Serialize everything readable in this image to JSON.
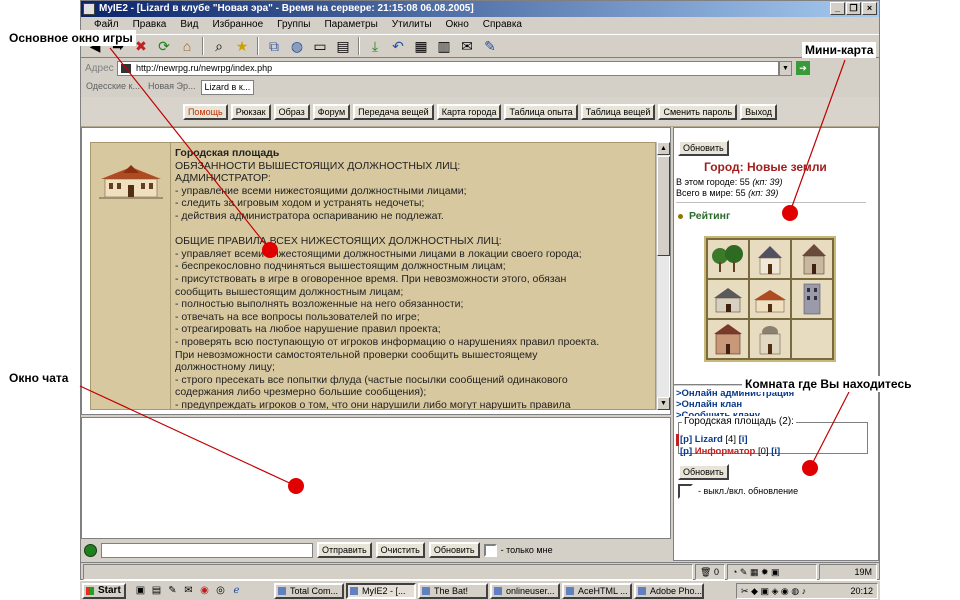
{
  "window": {
    "title": "MyIE2 - [Lizard в клубе \"Новая эра\" - Время на сервере: 21:15:08 06.08.2005]",
    "controls": [
      "_",
      "❐",
      "×"
    ]
  },
  "menu": [
    "Файл",
    "Правка",
    "Вид",
    "Избранное",
    "Группы",
    "Параметры",
    "Утилиты",
    "Окно",
    "Справка"
  ],
  "address": {
    "label": "Адрес",
    "url": "http://newrpg.ru/newrpg/index.php"
  },
  "page_tabs": [
    "Одесские к...",
    "Новая Эр...",
    "Lizard в к..."
  ],
  "game_buttons": [
    "Помощь",
    "Рюкзак",
    "Образ",
    "Форум",
    "Передача вещей",
    "Карта города",
    "Таблица опыта",
    "Таблица вещей",
    "Сменить пароль",
    "Выход"
  ],
  "main": {
    "lines": [
      "Городская площадь",
      "ОБЯЗАННОСТИ ВЫШЕСТОЯЩИХ ДОЛЖНОСТНЫХ ЛИЦ:",
      "АДМИНИСТРАТОР:",
      "- управление всеми нижестоящими должностными лицами;",
      "- следить за игровым ходом и устранять недочеты;",
      "- действия администратора оспариванию не подлежат.",
      "",
      "ОБЩИЕ ПРАВИЛА ВСЕХ НИЖЕСТОЯЩИХ ДОЛЖНОСТНЫХ ЛИЦ:",
      "- управляет всеми нижестоящими должностными лицами в локации своего города;",
      "- беспрекословно подчиняться вышестоящим должностным лицам;",
      "- присутствовать в игре в оговоренное время. При невозможности этого, обязан",
      "сообщить вышестоящим должностным лицам;",
      "- полностью выполнять возложенные на него обязанности;",
      "- отвечать на все вопросы пользователей по игре;",
      "- отреагировать на любое нарушение правил проекта;",
      "- проверять всю поступающую от игроков информацию о нарушениях правил проекта.",
      "При невозможности самостоятельной проверки сообщить вышестоящему",
      "должностному лицу;",
      "- строго пресекать все попытки флуда (частые посылки сообщений одинакового",
      "содержания либо чрезмерно большие сообщения);",
      "- предупреждать игроков о том, что они нарушили либо могут нарушить правила"
    ]
  },
  "chat": {
    "send": "Отправить",
    "clear": "Очистить",
    "refresh": "Обновить",
    "only_me": "- только мне"
  },
  "side": {
    "refresh": "Обновить",
    "city": "Город: Новые земли",
    "in_city": "В этом городе: 55",
    "in_city_kp": "(кп: 39)",
    "in_world": "Всего в мире: 55",
    "in_world_kp": "(кп: 39)",
    "rating": "Рейтинг",
    "links": [
      ">Онлайн администрация",
      ">Онлайн клан",
      ">Сообщить клану"
    ],
    "room_title": "Городская площадь (2):",
    "players": [
      {
        "tag": "[p]",
        "name": "Lizard",
        "level": "[4]",
        "info": "[i]"
      },
      {
        "tag": "[p]",
        "name": "Информатор",
        "level": "[0]",
        "info": "[i]"
      }
    ],
    "refresh2": "Обновить",
    "toggle_label": "- выкл./вкл. обновление"
  },
  "status": {
    "count": "0",
    "mem": "19M"
  },
  "taskbar": {
    "start": "Start",
    "tasks": [
      "Total Com...",
      "MyIE2 - [...",
      "The Bat!",
      "onlineuser...",
      "AceHTML ...",
      "Adobe Pho..."
    ],
    "time": "20:12"
  },
  "annotations": {
    "main_window": "Основное окно игры",
    "minimap": "Мини-карта",
    "chat_window": "Окно чата",
    "room": "Комната где Вы находитесь"
  },
  "colors": {
    "accent": "#c03000",
    "city": "#a02020",
    "link": "#0a3a8a",
    "parchment": "#d8c8a0",
    "marker": "#e00000"
  }
}
